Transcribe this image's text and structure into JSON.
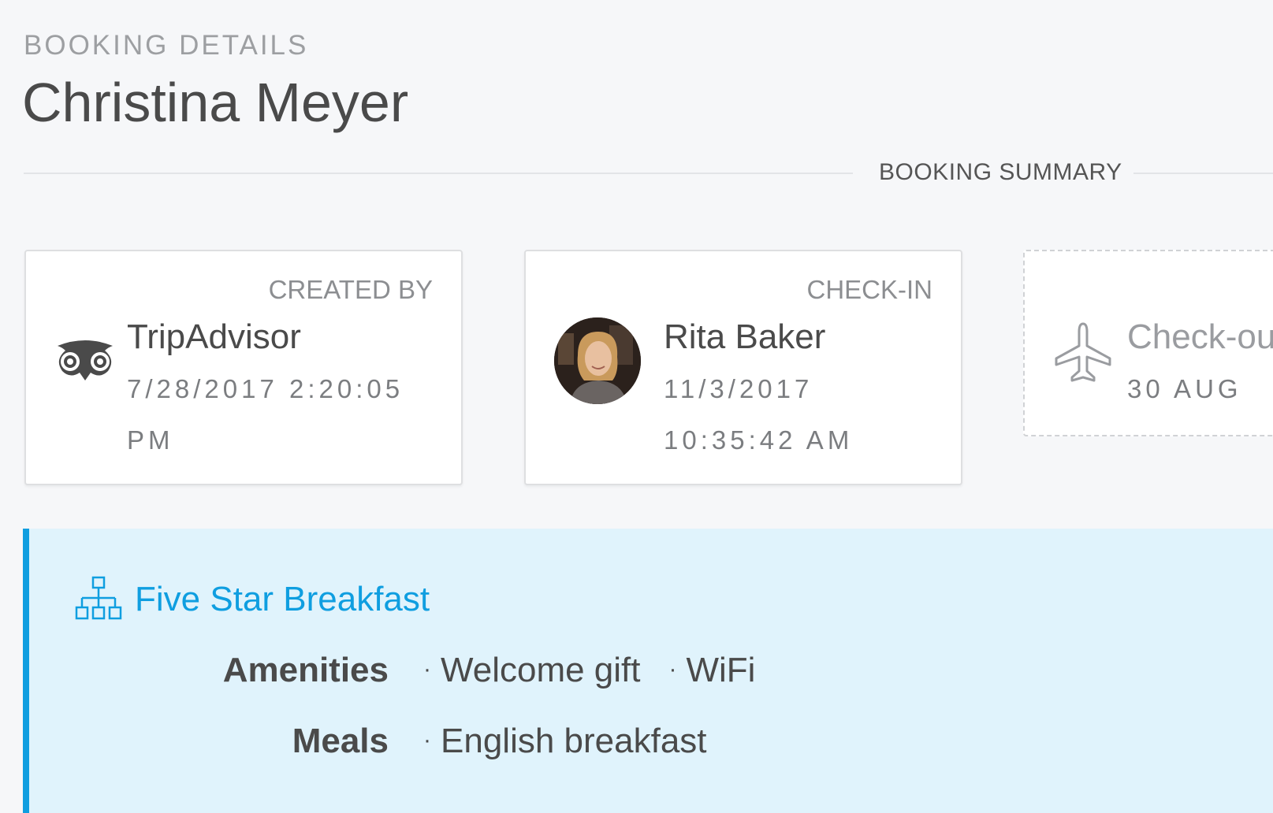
{
  "header": {
    "eyebrow": "BOOKING DETAILS",
    "guest_name": "Christina Meyer"
  },
  "section_divider": {
    "label": "BOOKING SUMMARY"
  },
  "cards": [
    {
      "caption": "CREATED BY",
      "title": "TripAdvisor",
      "timestamp": "7/28/2017 2:20:05 PM",
      "icon": "owl-icon"
    },
    {
      "caption": "CHECK-IN",
      "title": "Rita Baker",
      "timestamp": "11/3/2017 10:35:42 AM",
      "icon": "avatar"
    },
    {
      "caption": "",
      "title": "Check-out",
      "timestamp": "30 AUG",
      "icon": "plane-icon"
    }
  ],
  "package": {
    "title": "Five Star Breakfast",
    "icon": "sitemap-icon",
    "accent_color": "#0f9ee0",
    "background_color": "#e0f3fc",
    "features": [
      {
        "label": "Amenities",
        "values": [
          "Welcome gift",
          "WiFi"
        ]
      },
      {
        "label": "Meals",
        "values": [
          "English breakfast"
        ]
      }
    ]
  }
}
